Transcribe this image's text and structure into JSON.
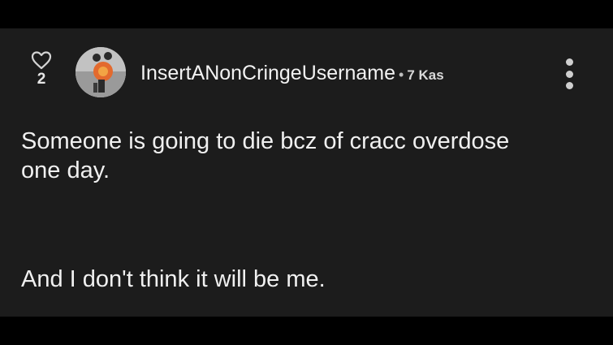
{
  "comment": {
    "like_count": "2",
    "username": "InsertANonCringeUsername",
    "separator": "•",
    "timestamp": "7 Kas",
    "body_lines": [
      "Someone is going to die bcz of cracc overdose",
      "one day.",
      "And I don't think it will be me."
    ]
  },
  "icons": {
    "like": "heart-outline-icon",
    "menu": "more-vertical-icon"
  },
  "colors": {
    "card_background": "#1c1c1c",
    "letterbox": "#000000",
    "text": "#f0f0f0"
  }
}
